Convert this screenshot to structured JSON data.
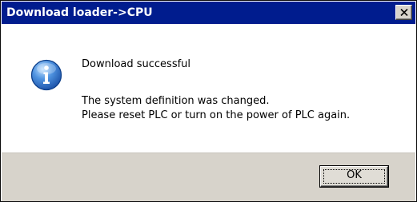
{
  "dialog": {
    "title": "Download loader->CPU",
    "close_icon": "close-icon",
    "icon": "info-icon",
    "message": {
      "line1": "Download successful",
      "line2": "The system definition was changed.",
      "line3": "Please reset PLC or turn on the power of PLC again."
    },
    "ok_label": "OK"
  },
  "colors": {
    "titlebar": "#001c8e",
    "footer": "#d7d3cb",
    "icon_blue": "#2f6fc6"
  }
}
